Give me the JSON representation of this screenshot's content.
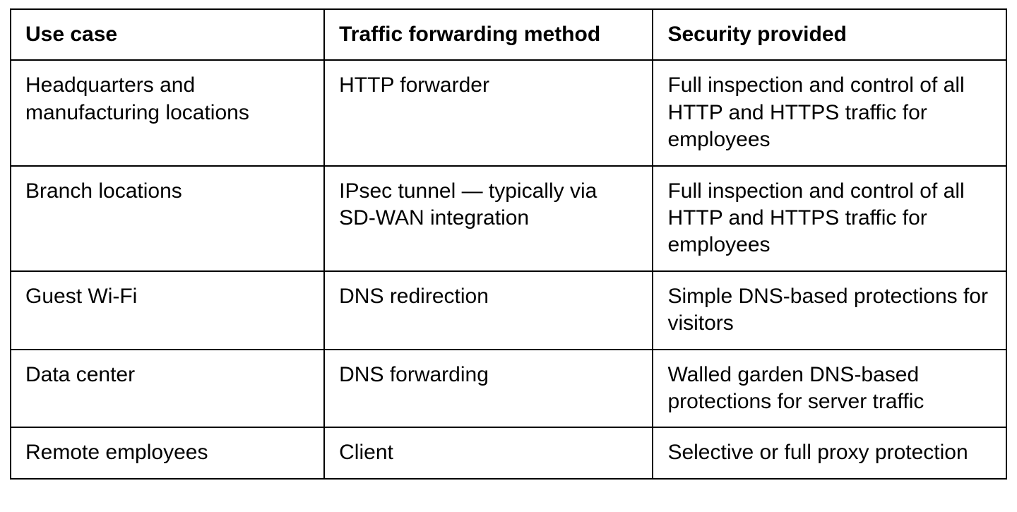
{
  "table": {
    "headers": [
      "Use case",
      "Traffic forwarding method",
      "Security provided"
    ],
    "rows": [
      {
        "use_case": "Headquarters and manufacturing locations",
        "method": "HTTP forwarder",
        "security": "Full inspection and control of all HTTP and HTTPS traffic for employees"
      },
      {
        "use_case": "Branch locations",
        "method": "IPsec tunnel — typically via SD-WAN integration",
        "security": "Full inspection and control of all HTTP and HTTPS traffic for employees"
      },
      {
        "use_case": "Guest Wi-Fi",
        "method": "DNS redirection",
        "security": "Simple DNS-based protections for visitors"
      },
      {
        "use_case": "Data center",
        "method": "DNS forwarding",
        "security": "Walled garden DNS-based protections for server traffic"
      },
      {
        "use_case": "Remote employees",
        "method": "Client",
        "security": "Selective or full proxy protection"
      }
    ]
  }
}
